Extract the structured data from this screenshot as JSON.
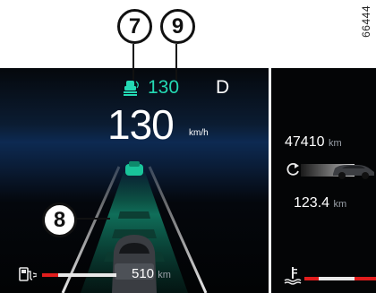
{
  "callouts": {
    "acc_icon_number": "7",
    "set_speed_number": "9",
    "lane_number": "8"
  },
  "reference_code": "66444",
  "cluster": {
    "set_speed": "130",
    "gear": "D",
    "speed": "130",
    "speed_unit": "km/h",
    "fuel_range": "510",
    "fuel_unit": "km",
    "odometer": "47410",
    "odometer_unit": "km",
    "trip": "123.4",
    "trip_unit": "km"
  },
  "icons": {
    "acc": "adaptive-cruise-icon",
    "fuel": "fuel-pump-icon",
    "trip_reset": "trip-reset-icon",
    "temp": "coolant-temperature-icon"
  },
  "colors": {
    "set_speed": "#24d9b4",
    "lane_highlight": "#19c49a",
    "warning": "#e21d1d"
  }
}
